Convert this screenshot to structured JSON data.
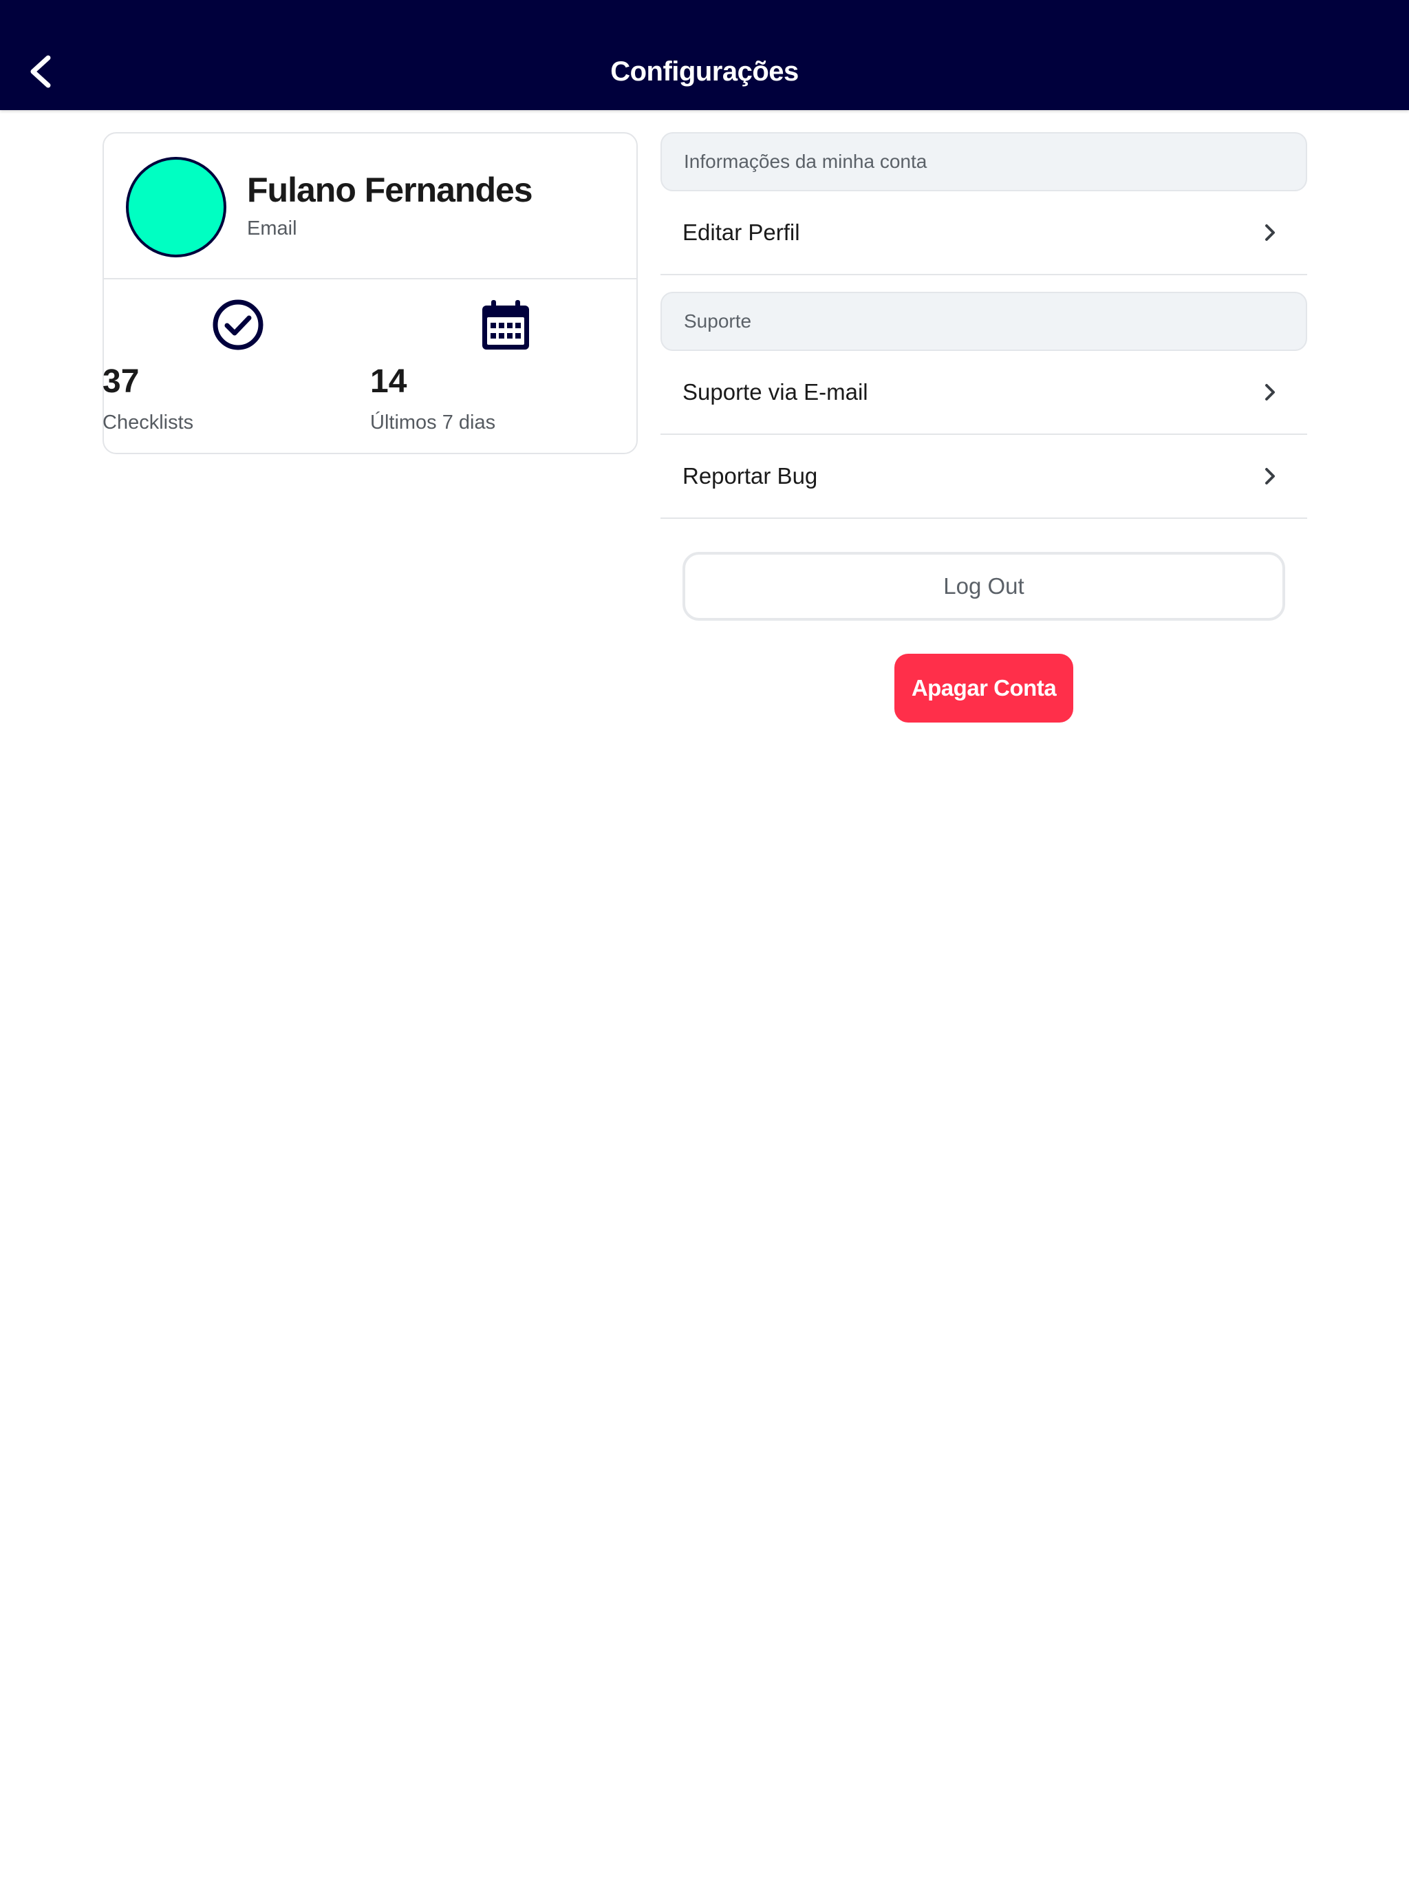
{
  "header": {
    "title": "Configurações",
    "back_icon": "chevron-left-icon"
  },
  "profile": {
    "name": "Fulano Fernandes",
    "email_label": "Email",
    "avatar_color": "#00FFC2",
    "stats": [
      {
        "icon": "check-circle-icon",
        "value": "37",
        "label": "Checklists"
      },
      {
        "icon": "calendar-icon",
        "value": "14",
        "label": "Últimos 7 dias"
      }
    ]
  },
  "sections": {
    "account": {
      "header": "Informações da minha conta",
      "items": [
        {
          "label": "Editar Perfil"
        }
      ]
    },
    "support": {
      "header": "Suporte",
      "items": [
        {
          "label": "Suporte via E-mail"
        },
        {
          "label": "Reportar Bug"
        }
      ]
    }
  },
  "actions": {
    "logout_label": "Log Out",
    "delete_label": "Apagar Conta"
  },
  "colors": {
    "header_bg": "#00003C",
    "accent": "#00FFC2",
    "danger": "#FF2F4A"
  }
}
